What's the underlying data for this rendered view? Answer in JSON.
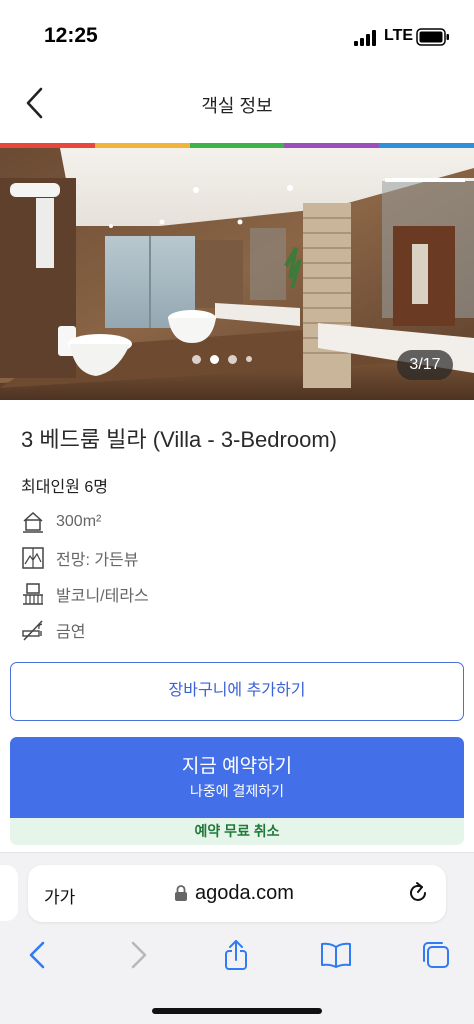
{
  "status_bar": {
    "time": "12:25",
    "network": "LTE"
  },
  "header": {
    "title": "객실 정보"
  },
  "rainbow_colors": [
    "#e8473b",
    "#f2b33a",
    "#3db34a",
    "#9b4fb8",
    "#2f8fd8"
  ],
  "gallery": {
    "counter": "3/17",
    "dots": 4,
    "active_dot": 1
  },
  "room": {
    "title": "3 베드룸 빌라 (Villa - 3-Bedroom)",
    "occupancy": "최대인원 6명",
    "features": [
      {
        "icon": "area-icon",
        "text": "300m²"
      },
      {
        "icon": "view-icon",
        "text": "전망: 가든뷰"
      },
      {
        "icon": "balcony-icon",
        "text": "발코니/테라스"
      },
      {
        "icon": "no-smoking-icon",
        "text": "금연"
      }
    ]
  },
  "actions": {
    "cart_label": "장바구니에 추가하기",
    "book_label": "지금 예약하기",
    "book_sub": "나중에 결제하기",
    "free_cancel": "예약 무료 취소"
  },
  "browser": {
    "text_size": "가가",
    "url": "agoda.com"
  },
  "colors": {
    "accent": "#4370e8",
    "link": "#3b62d6",
    "green": "#1f7a3a",
    "ios_blue": "#2f7cf6"
  }
}
